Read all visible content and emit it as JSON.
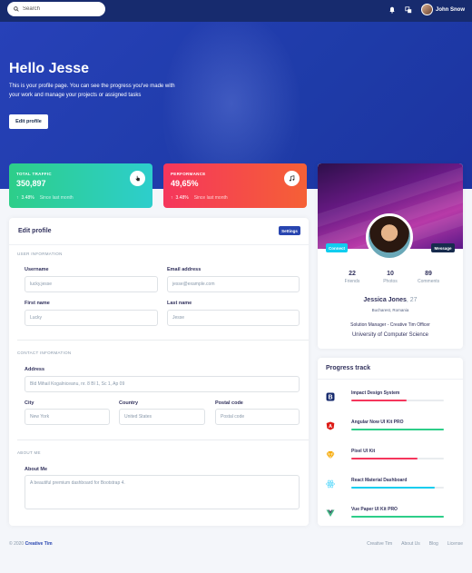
{
  "topbar": {
    "search_placeholder": "Search",
    "user_name": "John Snow"
  },
  "hero": {
    "greeting": "Hello Jesse",
    "description": "This is your profile page. You can see the progress you've made with your work and manage your projects or assigned tasks",
    "edit_button": "Edit profile"
  },
  "stats": [
    {
      "label": "TOTAL TRAFFIC",
      "value": "350,897",
      "change": "3.48%",
      "since": "Since last month",
      "gradient": [
        "#2dce89",
        "#2dcecc"
      ],
      "icon": "hand-pointer-icon"
    },
    {
      "label": "PERFORMANCE",
      "value": "49,65%",
      "change": "3.48%",
      "since": "Since last month",
      "gradient": [
        "#f5365c",
        "#f56036"
      ],
      "icon": "music-icon"
    }
  ],
  "edit_profile": {
    "title": "Edit profile",
    "settings_button": "Settings",
    "section_user": "USER INFORMATION",
    "section_contact": "CONTACT INFORMATION",
    "section_about": "ABOUT ME",
    "fields": {
      "username": {
        "label": "Username",
        "value": "lucky.jesse"
      },
      "email": {
        "label": "Email address",
        "placeholder": "jesse@example.com"
      },
      "first_name": {
        "label": "First name",
        "value": "Lucky"
      },
      "last_name": {
        "label": "Last name",
        "value": "Jesse"
      },
      "address": {
        "label": "Address",
        "value": "Bld Mihail Kogalniceanu, nr. 8 Bl 1, Sc 1, Ap 09"
      },
      "city": {
        "label": "City",
        "value": "New York"
      },
      "country": {
        "label": "Country",
        "value": "United States"
      },
      "postal": {
        "label": "Postal code",
        "placeholder": "Postal code"
      },
      "about": {
        "label": "About Me",
        "placeholder": "A beautiful premium dashboard for Bootstrap 4."
      }
    }
  },
  "profile_card": {
    "connect": "Connect",
    "message": "Message",
    "friends": {
      "count": "22",
      "label": "Friends"
    },
    "photos": {
      "count": "10",
      "label": "Photos"
    },
    "comments": {
      "count": "89",
      "label": "Comments"
    },
    "name": "Jessica Jones",
    "age": ", 27",
    "location": "Bucharest, Romania",
    "job": "Solution Manager - Creative Tim Officer",
    "education": "University of Computer Science"
  },
  "progress": {
    "title": "Progress track",
    "items": [
      {
        "name": "Impact Design System",
        "percent": 60,
        "color": "#f5365c",
        "icon": "bootstrap-icon",
        "icon_color": "#172b6e"
      },
      {
        "name": "Angular Now UI Kit PRO",
        "percent": 100,
        "color": "#2dce89",
        "icon": "angular-icon",
        "icon_color": "#dd1b16"
      },
      {
        "name": "Pixel UI Kit",
        "percent": 72,
        "color": "#f5365c",
        "icon": "sketch-icon",
        "icon_color": "#f7a800"
      },
      {
        "name": "React Material Dashboard",
        "percent": 90,
        "color": "#11cdef",
        "icon": "react-icon",
        "icon_color": "#61dafb"
      },
      {
        "name": "Vue Paper UI Kit PRO",
        "percent": 100,
        "color": "#2dce89",
        "icon": "vue-icon",
        "icon_color": "#41b883"
      }
    ]
  },
  "footer": {
    "copyright": "© 2020 ",
    "brand": "Creative Tim",
    "links": [
      "Creative Tim",
      "About Us",
      "Blog",
      "License"
    ]
  }
}
